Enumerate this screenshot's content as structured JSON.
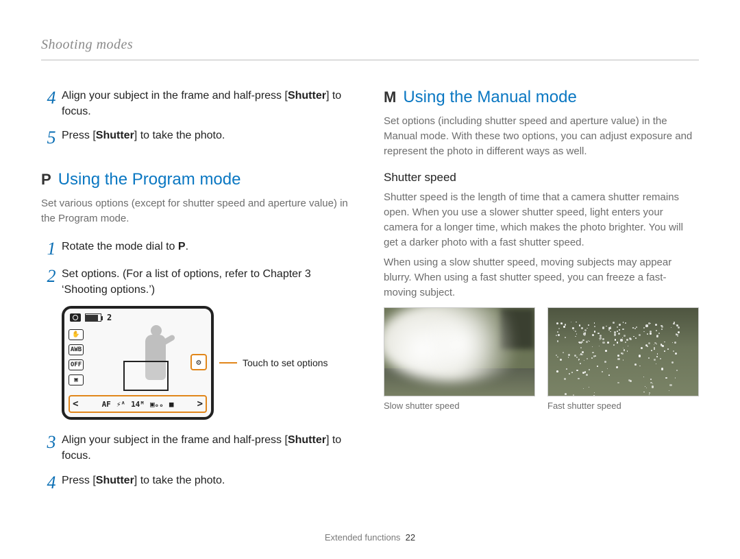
{
  "header": {
    "running_title": "Shooting modes"
  },
  "left": {
    "steps_a": [
      {
        "num": "4",
        "html": "Align your subject in the frame and half-press [<b>Shutter</b>] to focus."
      },
      {
        "num": "5",
        "html": "Press [<b>Shutter</b>] to take the photo."
      }
    ],
    "section_p": {
      "mode_letter": "P",
      "title": "Using the Program mode",
      "intro": "Set various options (except for shutter speed and aperture value) in the Program mode."
    },
    "steps_b": [
      {
        "num": "1",
        "html": "Rotate the mode dial to <b>P</b>."
      },
      {
        "num": "2",
        "html": "Set options. (For a list of options, refer to Chapter 3 ‘Shooting options.’)"
      }
    ],
    "lcd": {
      "remaining": "2",
      "left_icons": [
        "✋",
        "AWB",
        "OFF",
        "▣"
      ],
      "settings_glyph": "⚙",
      "bottom_items": [
        "AF",
        "⚡ᴬ",
        "14ᴹ",
        "▣ₒₒ",
        "■"
      ],
      "callout": "Touch to set options"
    },
    "steps_c": [
      {
        "num": "3",
        "html": "Align your subject in the frame and half-press [<b>Shutter</b>] to focus."
      },
      {
        "num": "4",
        "html": "Press [<b>Shutter</b>] to take the photo."
      }
    ]
  },
  "right": {
    "section_m": {
      "mode_letter": "M",
      "title": "Using the Manual mode",
      "intro": "Set options (including shutter speed and aperture value) in the Manual mode. With these two options, you can adjust exposure and represent the photo in different ways as well."
    },
    "shutter": {
      "heading": "Shutter speed",
      "p1": "Shutter speed is the length of time that a camera shutter remains open. When you use a slower shutter speed, light enters your camera for a longer time, which makes the photo brighter. You will get a darker photo with a fast shutter speed.",
      "p2": "When using a slow shutter speed, moving subjects may appear blurry. When using a fast shutter speed, you can freeze a fast-moving subject.",
      "cap_slow": "Slow shutter speed",
      "cap_fast": "Fast shutter speed"
    }
  },
  "footer": {
    "section": "Extended functions",
    "page": "22"
  }
}
